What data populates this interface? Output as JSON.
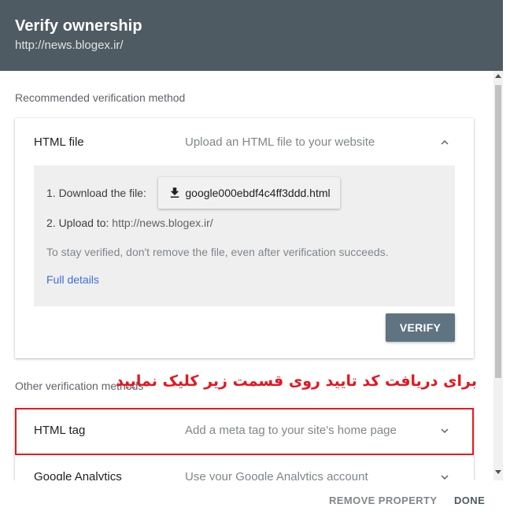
{
  "dialog": {
    "title": "Verify ownership",
    "property_url": "http://news.blogex.ir/"
  },
  "recommended": {
    "section_label": "Recommended verification method",
    "method_name": "HTML file",
    "method_description": "Upload an HTML file to your website",
    "expanded": true,
    "step1_label": "1. Download the file:",
    "download_filename": "google000ebdf4c4ff3ddd.html",
    "step2_label": "2. Upload to:",
    "step2_url": "http://news.blogex.ir/",
    "note": "To stay verified, don't remove the file, even after verification succeeds.",
    "full_details_link": "Full details",
    "verify_button": "VERIFY"
  },
  "other": {
    "section_label": "Other verification methods",
    "annotation": "برای دریافت کد تایید روی قسمت زیر کلیک نمایید",
    "methods": [
      {
        "name": "HTML tag",
        "description": "Add a meta tag to your site's home page"
      },
      {
        "name": "Google Analytics",
        "description": "Use your Google Analytics account"
      }
    ]
  },
  "footer": {
    "remove_property": "REMOVE PROPERTY",
    "done": "DONE"
  },
  "colors": {
    "header_bg": "#4f5b62",
    "verify_button_bg": "#5f7480",
    "link": "#3c6ee0",
    "annotation_red": "#e8141d"
  }
}
